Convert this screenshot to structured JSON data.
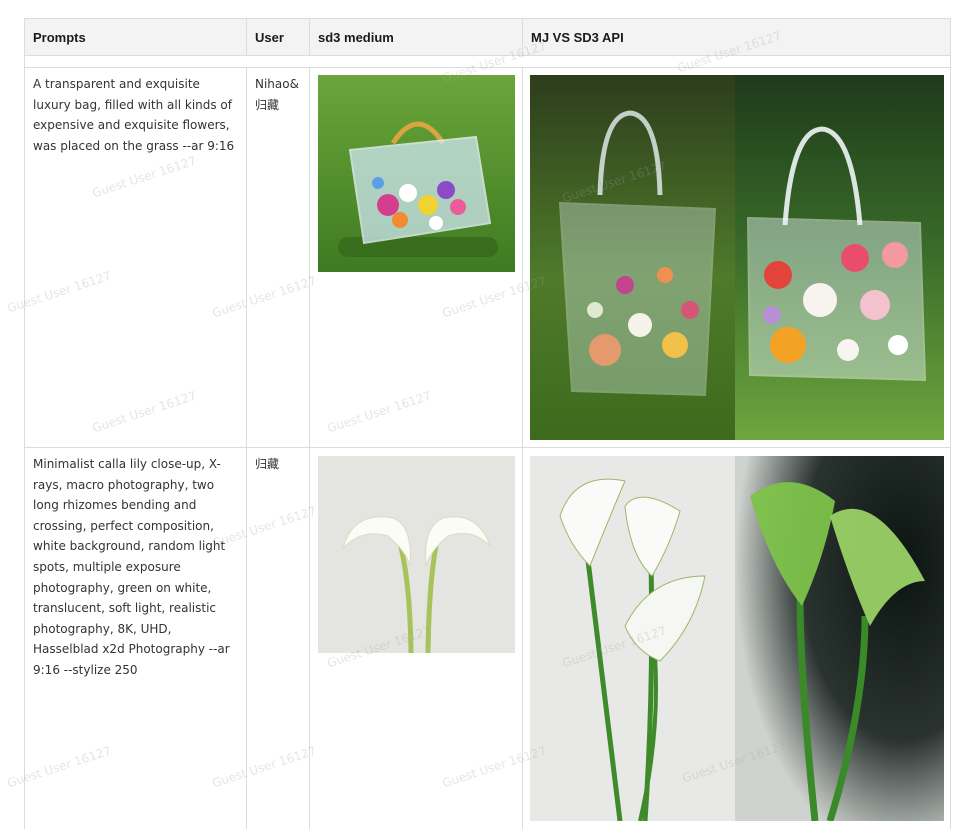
{
  "table": {
    "headers": [
      "Prompts",
      "User",
      "sd3 medium",
      "MJ VS SD3 API"
    ],
    "rows": [
      {
        "prompt": "A transparent and exquisite luxury bag, filled with all kinds of expensive and exquisite flowers, was placed on the grass --ar 9:16",
        "user": "Nihao&归藏"
      },
      {
        "prompt": "Minimalist calla lily close-up, X-rays, macro photography, two long rhizomes bending and crossing, perfect composition, white background, random light spots, multiple exposure photography, green on white, translucent, soft light, realistic photography, 8K, UHD, Hasselblad x2d Photography --ar 9:16 --stylize 250",
        "user": "归藏"
      }
    ]
  },
  "watermark": "Guest User 16127",
  "colors": {
    "header_bg": "#f3f3f3",
    "border": "#dcdcdc",
    "grass": "#4f8a2a",
    "lily_green": "#5c9a2e"
  }
}
